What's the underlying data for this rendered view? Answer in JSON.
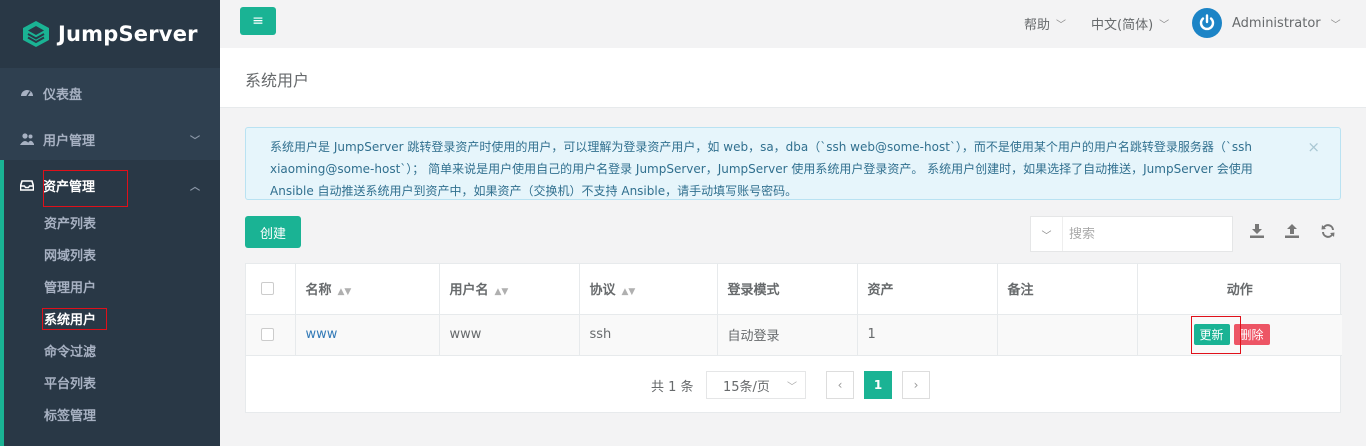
{
  "app": {
    "name": "JumpServer"
  },
  "sidebar": {
    "items": [
      {
        "label": "仪表盘",
        "icon": "dashboard-icon"
      },
      {
        "label": "用户管理",
        "icon": "users-icon"
      },
      {
        "label": "资产管理",
        "icon": "inbox-icon"
      }
    ],
    "sub_items": [
      {
        "label": "资产列表"
      },
      {
        "label": "网域列表"
      },
      {
        "label": "管理用户"
      },
      {
        "label": "系统用户"
      },
      {
        "label": "命令过滤"
      },
      {
        "label": "平台列表"
      },
      {
        "label": "标签管理"
      }
    ]
  },
  "topbar": {
    "help": "帮助",
    "language": "中文(简体)",
    "user": "Administrator"
  },
  "page": {
    "title": "系统用户"
  },
  "alert": {
    "text": "系统用户是 JumpServer 跳转登录资产时使用的用户，可以理解为登录资产用户，如 web，sa，dba（`ssh web@some-host`），而不是使用某个用户的用户名跳转登录服务器（`ssh xiaoming@some-host`）； 简单来说是用户使用自己的用户名登录 JumpServer，JumpServer 使用系统用户登录资产。 系统用户创建时，如果选择了自动推送，JumpServer 会使用 Ansible 自动推送系统用户到资产中，如果资产（交换机）不支持 Ansible，请手动填写账号密码。",
    "close": "×"
  },
  "toolbar": {
    "create": "创建",
    "search_placeholder": "搜索"
  },
  "table": {
    "headers": [
      "名称",
      "用户名",
      "协议",
      "登录模式",
      "资产",
      "备注",
      "动作"
    ],
    "rows": [
      {
        "name": "www",
        "username": "www",
        "protocol": "ssh",
        "login_mode": "自动登录",
        "assets": "1",
        "comment": "",
        "update": "更新",
        "delete": "删除"
      }
    ]
  },
  "pagination": {
    "total": "共 1 条",
    "page_size": "15条/页",
    "current_page": "1"
  },
  "colors": {
    "accent": "#1ab394",
    "sidebar": "#2f4050",
    "danger": "#ed5565"
  }
}
